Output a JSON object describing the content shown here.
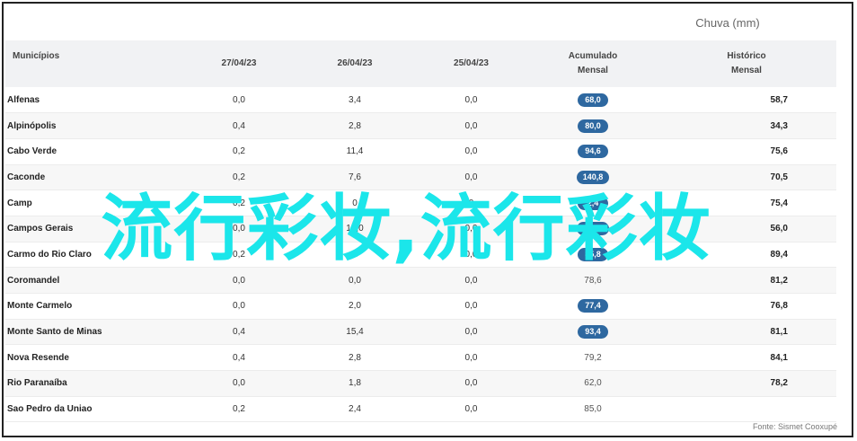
{
  "unit_caption": "Chuva (mm)",
  "headers": {
    "name": "Municípios",
    "d1": "27/04/23",
    "d2": "26/04/23",
    "d3": "25/04/23",
    "acc_line1": "Acumulado",
    "acc_line2": "Mensal",
    "hist_line1": "Histórico",
    "hist_line2": "Mensal"
  },
  "rows": [
    {
      "name": "Alfenas",
      "d1": "0,0",
      "d2": "3,4",
      "d3": "0,0",
      "acc": "68,0",
      "acc_badge": true,
      "hist": "58,7"
    },
    {
      "name": "Alpinópolis",
      "d1": "0,4",
      "d2": "2,8",
      "d3": "0,0",
      "acc": "80,0",
      "acc_badge": true,
      "hist": "34,3"
    },
    {
      "name": "Cabo Verde",
      "d1": "0,2",
      "d2": "11,4",
      "d3": "0,0",
      "acc": "94,6",
      "acc_badge": true,
      "hist": "75,6"
    },
    {
      "name": "Caconde",
      "d1": "0,2",
      "d2": "7,6",
      "d3": "0,0",
      "acc": "140,8",
      "acc_badge": true,
      "hist": "70,5"
    },
    {
      "name": "Camp",
      "d1": "0,2",
      "d2": "0",
      "d3": "0",
      "acc": "2,4",
      "acc_badge": true,
      "hist": "75,4"
    },
    {
      "name": "Campos Gerais",
      "d1": "0,0",
      "d2": "13,0",
      "d3": "0,0",
      "acc": "123,8",
      "acc_badge": true,
      "hist": "56,0"
    },
    {
      "name": "Carmo do Rio Claro",
      "d1": "0,2",
      "d2": "2",
      "d3": "0,0",
      "acc": "85,8",
      "acc_badge": true,
      "hist": "89,4"
    },
    {
      "name": "Coromandel",
      "d1": "0,0",
      "d2": "0,0",
      "d3": "0,0",
      "acc": "78,6",
      "acc_badge": false,
      "hist": "81,2"
    },
    {
      "name": "Monte Carmelo",
      "d1": "0,0",
      "d2": "2,0",
      "d3": "0,0",
      "acc": "77,4",
      "acc_badge": true,
      "hist": "76,8"
    },
    {
      "name": "Monte Santo de Minas",
      "d1": "0,4",
      "d2": "15,4",
      "d3": "0,0",
      "acc": "93,4",
      "acc_badge": true,
      "hist": "81,1"
    },
    {
      "name": "Nova Resende",
      "d1": "0,4",
      "d2": "2,8",
      "d3": "0,0",
      "acc": "79,2",
      "acc_badge": false,
      "hist": "84,1"
    },
    {
      "name": "Rio Paranaíba",
      "d1": "0,0",
      "d2": "1,8",
      "d3": "0,0",
      "acc": "62,0",
      "acc_badge": false,
      "hist": "78,2"
    },
    {
      "name": "Sao Pedro da Uniao",
      "d1": "0,2",
      "d2": "2,4",
      "d3": "0,0",
      "acc": "85,0",
      "acc_badge": false,
      "hist": ""
    }
  ],
  "source": "Fonte: Sismet Cooxupé",
  "watermark": "流行彩妆,流行彩妆",
  "colors": {
    "badge": "#2e68a0",
    "watermark": "#1be6ea",
    "header_bg": "#f1f2f4"
  }
}
